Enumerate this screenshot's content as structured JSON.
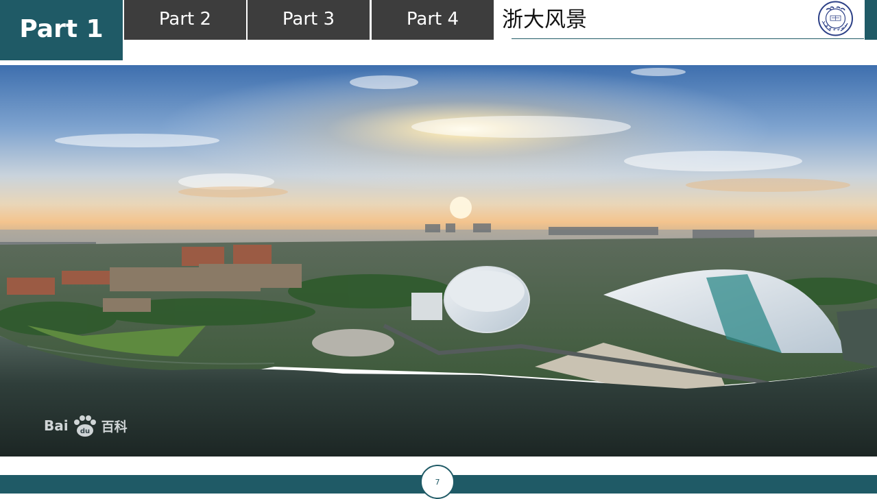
{
  "nav": {
    "tabs": [
      {
        "label": "Part 1",
        "active": true
      },
      {
        "label": "Part 2",
        "active": false
      },
      {
        "label": "Part 3",
        "active": false
      },
      {
        "label": "Part 4",
        "active": false
      }
    ]
  },
  "slide": {
    "title": "浙大风景",
    "page_number": "7"
  },
  "logo": {
    "icon": "university-seal-icon"
  },
  "photo": {
    "icon": "campus-panorama-photo",
    "watermark": {
      "text_a": "Bai",
      "icon": "baidu-paw-icon",
      "text_b": "百科"
    }
  },
  "colors": {
    "accent": "#1f5a66",
    "tab_inactive": "#3d3d3d",
    "text_light": "#ffffff"
  }
}
